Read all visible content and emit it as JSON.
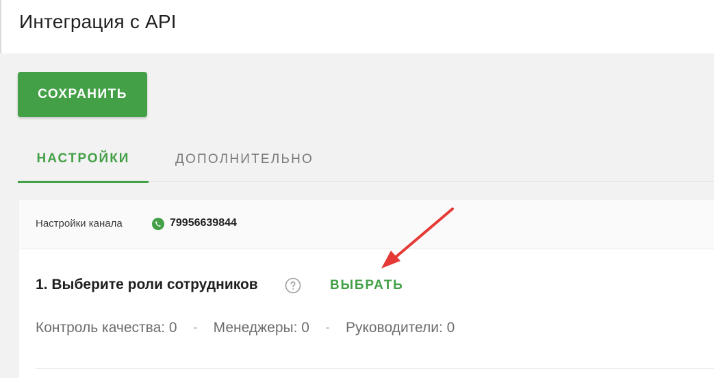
{
  "header": {
    "title": "Интеграция с API"
  },
  "toolbar": {
    "save_label": "СОХРАНИТЬ"
  },
  "tabs": [
    {
      "label": "НАСТРОЙКИ",
      "active": true
    },
    {
      "label": "ДОПОЛНИТЕЛЬНО",
      "active": false
    }
  ],
  "channel": {
    "label": "Настройки канала",
    "icon": "whatsapp-icon",
    "phone": "79956639844"
  },
  "step1": {
    "title": "1. Выберите роли сотрудников",
    "help_icon": "question-circle-icon",
    "action_label": "ВЫБРАТЬ"
  },
  "roles": [
    {
      "label": "Контроль качества: 0"
    },
    {
      "label": "Менеджеры: 0"
    },
    {
      "label": "Руководители: 0"
    }
  ],
  "colors": {
    "accent": "#43a047",
    "annotation_arrow": "#e53935"
  }
}
